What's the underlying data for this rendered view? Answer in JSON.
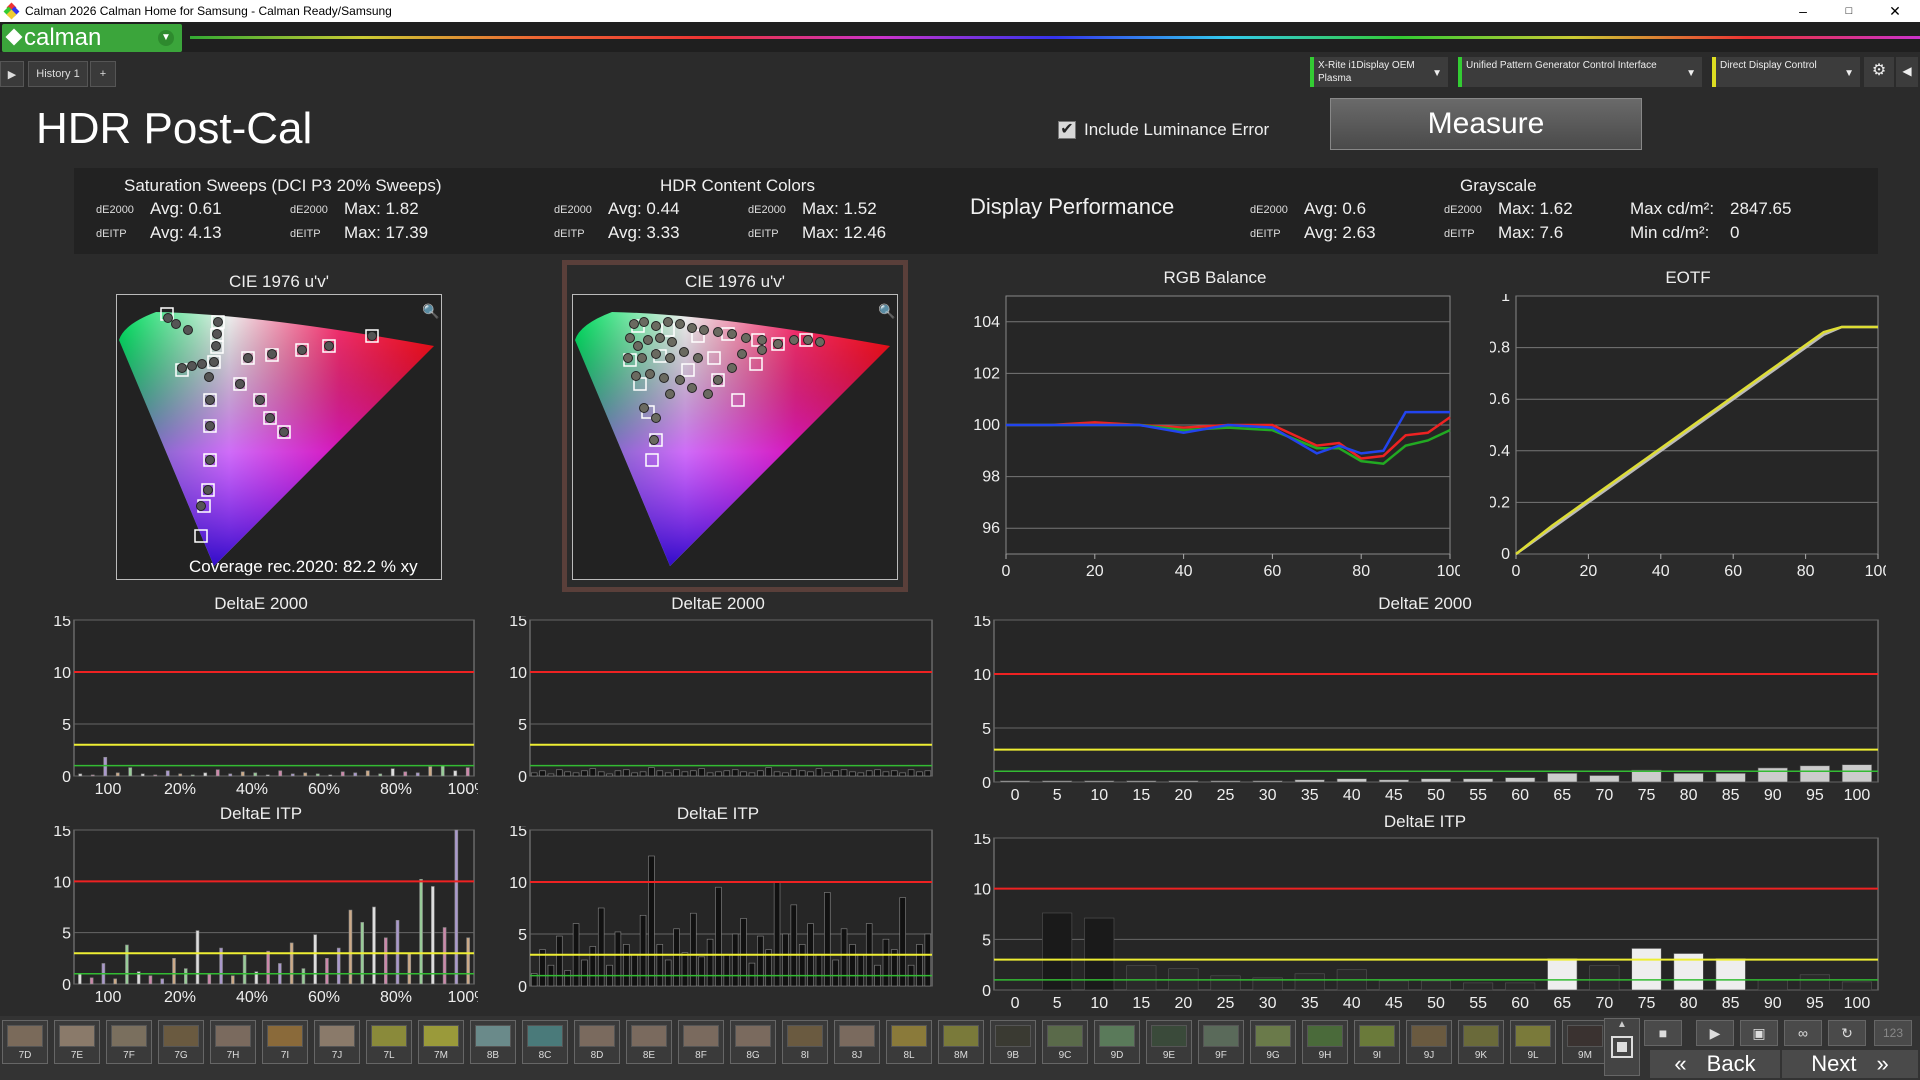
{
  "window": {
    "title": "Calman 2026 Calman Home for Samsung  - Calman Ready/Samsung",
    "minimize": "–",
    "maximize": "□",
    "close": "✕"
  },
  "logo": {
    "text": "calman"
  },
  "tabs": {
    "play": "▶",
    "history": "History 1",
    "add": "+"
  },
  "devices": [
    {
      "label": "X-Rite i1Display OEM Plasma",
      "color": "#33cc33"
    },
    {
      "label": "Unified Pattern Generator Control Interface",
      "color": "#33cc33"
    },
    {
      "label": "Direct Display Control",
      "color": "#dddd22"
    }
  ],
  "page": {
    "title": "HDR Post-Cal",
    "include_luminance": "Include Luminance Error",
    "measure": "Measure"
  },
  "summary": {
    "sat": {
      "title": "Saturation Sweeps (DCI P3 20% Sweeps)",
      "de2000": "dE2000",
      "deitp": "dEITP",
      "avg2000": "Avg: 0.61",
      "max2000": "Max: 1.82",
      "avgitp": "Avg: 4.13",
      "maxitp": "Max: 17.39"
    },
    "hdr": {
      "title": "HDR Content Colors",
      "avg2000": "Avg: 0.44",
      "max2000": "Max: 1.52",
      "avgitp": "Avg: 3.33",
      "maxitp": "Max: 12.46"
    },
    "perf": "Display Performance",
    "gray": {
      "title": "Grayscale",
      "avg2000": "Avg: 0.6",
      "max2000": "Max: 1.62",
      "avgitp": "Avg: 2.63",
      "maxitp": "Max: 7.6",
      "maxcd": "Max cd/m²:",
      "maxcd_val": "2847.65",
      "mincd": "Min cd/m²:",
      "mincd_val": "0"
    }
  },
  "cie1": {
    "title": "CIE 1976 u'v'",
    "coverage": "Coverage rec.2020:  82.2 % xy"
  },
  "cie2": {
    "title": "CIE 1976 u'v'"
  },
  "chart_data": [
    {
      "type": "line",
      "title": "RGB Balance",
      "x": [
        0,
        10,
        20,
        30,
        40,
        50,
        60,
        70,
        75,
        80,
        85,
        90,
        95,
        100
      ],
      "xlim": [
        0,
        100
      ],
      "ylim": [
        95,
        105
      ],
      "yticks": [
        96,
        98,
        100,
        102,
        104
      ],
      "xticks": [
        0,
        20,
        40,
        60,
        80,
        100
      ],
      "series": [
        {
          "color": "#ee2222",
          "values": [
            100,
            100,
            100.1,
            100,
            99.9,
            100,
            100,
            99.2,
            99.3,
            98.7,
            98.8,
            99.6,
            99.7,
            100.3
          ]
        },
        {
          "color": "#22aa22",
          "values": [
            100,
            100,
            100,
            100,
            99.8,
            99.9,
            99.8,
            99.1,
            99.1,
            98.6,
            98.5,
            99.2,
            99.4,
            99.8
          ]
        },
        {
          "color": "#2244ee",
          "values": [
            100,
            100,
            100,
            100,
            99.7,
            100,
            99.9,
            98.9,
            99.2,
            98.9,
            99.0,
            100.5,
            100.5,
            100.5
          ]
        }
      ]
    },
    {
      "type": "line",
      "title": "EOTF",
      "x": [
        0,
        10,
        20,
        30,
        40,
        50,
        60,
        70,
        80,
        85,
        90,
        100
      ],
      "xlim": [
        0,
        100
      ],
      "ylim": [
        0,
        1
      ],
      "yticks": [
        0,
        0.2,
        0.4,
        0.6,
        0.8,
        1
      ],
      "xticks": [
        0,
        20,
        40,
        60,
        80,
        100
      ],
      "series": [
        {
          "color": "#bbbbbb",
          "values": [
            0,
            0.1,
            0.2,
            0.3,
            0.4,
            0.5,
            0.6,
            0.7,
            0.8,
            0.85,
            0.88,
            0.88
          ]
        },
        {
          "color": "#dddd33",
          "values": [
            0,
            0.11,
            0.21,
            0.31,
            0.41,
            0.51,
            0.61,
            0.71,
            0.81,
            0.86,
            0.88,
            0.88
          ]
        }
      ]
    },
    {
      "type": "bar",
      "title": "DeltaE 2000",
      "ylim": [
        0,
        15
      ],
      "yticks": [
        0,
        5,
        10,
        15
      ],
      "xticklabels": [
        "100",
        "20%",
        "40%",
        "60%",
        "80%",
        "100%"
      ],
      "values": [
        0.2,
        0.1,
        1.8,
        0.3,
        0.8,
        0.2,
        0.1,
        0.5,
        0.2,
        0.1,
        0.3,
        0.6,
        0.2,
        0.4,
        0.3,
        0.1,
        0.5,
        0.2,
        0.3,
        0.2,
        0.1,
        0.4,
        0.3,
        0.5,
        0.2,
        0.7,
        0.4,
        0.3,
        0.9,
        1.0,
        0.5,
        0.8
      ]
    },
    {
      "type": "bar",
      "title": "DeltaE 2000",
      "ylim": [
        0,
        15
      ],
      "yticks": [
        0,
        5,
        10,
        15
      ],
      "values": [
        0.3,
        0.5,
        0.2,
        0.6,
        0.4,
        0.3,
        0.5,
        0.7,
        0.4,
        0.2,
        0.5,
        0.6,
        0.3,
        0.4,
        0.8,
        0.5,
        0.3,
        0.6,
        0.4,
        0.5,
        0.7,
        0.3,
        0.4,
        0.5,
        0.6,
        0.4,
        0.3,
        0.5,
        0.8,
        0.4,
        0.3,
        0.6,
        0.5,
        0.4,
        0.7,
        0.3,
        0.5,
        0.6,
        0.4,
        0.3,
        0.5,
        0.6,
        0.4,
        0.5,
        0.3,
        0.6,
        0.4,
        0.5
      ]
    },
    {
      "type": "bar",
      "title": "DeltaE 2000",
      "ylim": [
        0,
        15
      ],
      "yticks": [
        0,
        5,
        10,
        15
      ],
      "xticklabels": [
        "0",
        "5",
        "10",
        "15",
        "20",
        "25",
        "30",
        "35",
        "40",
        "45",
        "50",
        "55",
        "60",
        "65",
        "70",
        "75",
        "80",
        "85",
        "90",
        "95",
        "100"
      ],
      "values": [
        0.1,
        0.1,
        0.1,
        0.1,
        0.1,
        0.1,
        0.1,
        0.2,
        0.3,
        0.2,
        0.3,
        0.3,
        0.4,
        0.8,
        0.6,
        1.1,
        0.8,
        0.8,
        1.3,
        1.5,
        1.6
      ]
    },
    {
      "type": "bar",
      "title": "DeltaE ITP",
      "ylim": [
        0,
        15
      ],
      "yticks": [
        0,
        5,
        10,
        15
      ],
      "xticklabels": [
        "100",
        "20%",
        "40%",
        "60%",
        "80%",
        "100%"
      ],
      "values": [
        1.0,
        0.6,
        2.0,
        0.5,
        3.8,
        1.2,
        0.8,
        0.5,
        2.5,
        1.5,
        5.2,
        1.0,
        3.5,
        0.8,
        2.8,
        1.2,
        3.2,
        2.0,
        4.0,
        1.5,
        4.8,
        2.5,
        3.5,
        7.2,
        6.0,
        7.5,
        4.5,
        6.2,
        3.0,
        10.2,
        9.5,
        5.5,
        15.0,
        4.5
      ]
    },
    {
      "type": "bar",
      "title": "DeltaE ITP",
      "ylim": [
        0,
        15
      ],
      "yticks": [
        0,
        5,
        10,
        15
      ],
      "values": [
        1.2,
        3.5,
        2.0,
        4.8,
        1.5,
        6.0,
        2.5,
        3.8,
        7.5,
        2.0,
        5.2,
        4.0,
        3.0,
        6.8,
        12.5,
        4.0,
        2.5,
        5.5,
        3.2,
        7.0,
        2.8,
        4.5,
        9.5,
        3.0,
        5.0,
        6.5,
        2.2,
        4.8,
        3.5,
        10.0,
        5.0,
        7.8,
        4.0,
        6.0,
        3.0,
        9.0,
        2.5,
        5.5,
        4.0,
        3.0,
        6.0,
        2.0,
        4.5,
        3.5,
        8.5,
        2.0,
        4.0,
        5.0
      ]
    },
    {
      "type": "bar",
      "title": "DeltaE ITP",
      "ylim": [
        0,
        15
      ],
      "yticks": [
        0,
        5,
        10,
        15
      ],
      "xticklabels": [
        "0",
        "5",
        "10",
        "15",
        "20",
        "25",
        "30",
        "35",
        "40",
        "45",
        "50",
        "55",
        "60",
        "65",
        "70",
        "75",
        "80",
        "85",
        "90",
        "95",
        "100"
      ],
      "values": [
        0,
        7.6,
        7.1,
        2.4,
        2.1,
        1.4,
        1.2,
        1.6,
        2.0,
        0.9,
        0.9,
        0.7,
        0.7,
        3.1,
        2.4,
        4.1,
        3.6,
        3.1,
        1.0,
        1.5,
        0.8
      ]
    }
  ],
  "swatches": [
    {
      "label": "7D",
      "color": "#7a6a5a"
    },
    {
      "label": "7E",
      "color": "#8a7a6a"
    },
    {
      "label": "7F",
      "color": "#7a6f5e"
    },
    {
      "label": "7G",
      "color": "#6a5a40"
    },
    {
      "label": "7H",
      "color": "#7a6a5e"
    },
    {
      "label": "7I",
      "color": "#8a6a3a"
    },
    {
      "label": "7J",
      "color": "#8a7a6a"
    },
    {
      "label": "7L",
      "color": "#8a8a3a"
    },
    {
      "label": "7M",
      "color": "#9a9a3a"
    },
    {
      "label": "8B",
      "color": "#6a8a8a"
    },
    {
      "label": "8C",
      "color": "#4a7a7a"
    },
    {
      "label": "8D",
      "color": "#7a6a5e"
    },
    {
      "label": "8E",
      "color": "#7a6a5e"
    },
    {
      "label": "8F",
      "color": "#7a6a5e"
    },
    {
      "label": "8G",
      "color": "#7a6a5e"
    },
    {
      "label": "8I",
      "color": "#6a5a40"
    },
    {
      "label": "8J",
      "color": "#7a6a5e"
    },
    {
      "label": "8L",
      "color": "#8a7a3a"
    },
    {
      "label": "8M",
      "color": "#7a7a3a"
    },
    {
      "label": "9B",
      "color": "#3a3a32"
    },
    {
      "label": "9C",
      "color": "#5a6a4a"
    },
    {
      "label": "9D",
      "color": "#5a7a5a"
    },
    {
      "label": "9E",
      "color": "#3a4a3a"
    },
    {
      "label": "9F",
      "color": "#5a6a5a"
    },
    {
      "label": "9G",
      "color": "#6a7a4a"
    },
    {
      "label": "9H",
      "color": "#4a6a3a"
    },
    {
      "label": "9I",
      "color": "#6a7a3a"
    },
    {
      "label": "9J",
      "color": "#6a5a40"
    },
    {
      "label": "9K",
      "color": "#6a6a3a"
    },
    {
      "label": "9L",
      "color": "#7a7a3a"
    },
    {
      "label": "9M",
      "color": "#3a3230"
    }
  ],
  "nav": {
    "back": "Back",
    "next": "Next",
    "counter": "123",
    "back_icon": "«",
    "next_icon": "»"
  }
}
